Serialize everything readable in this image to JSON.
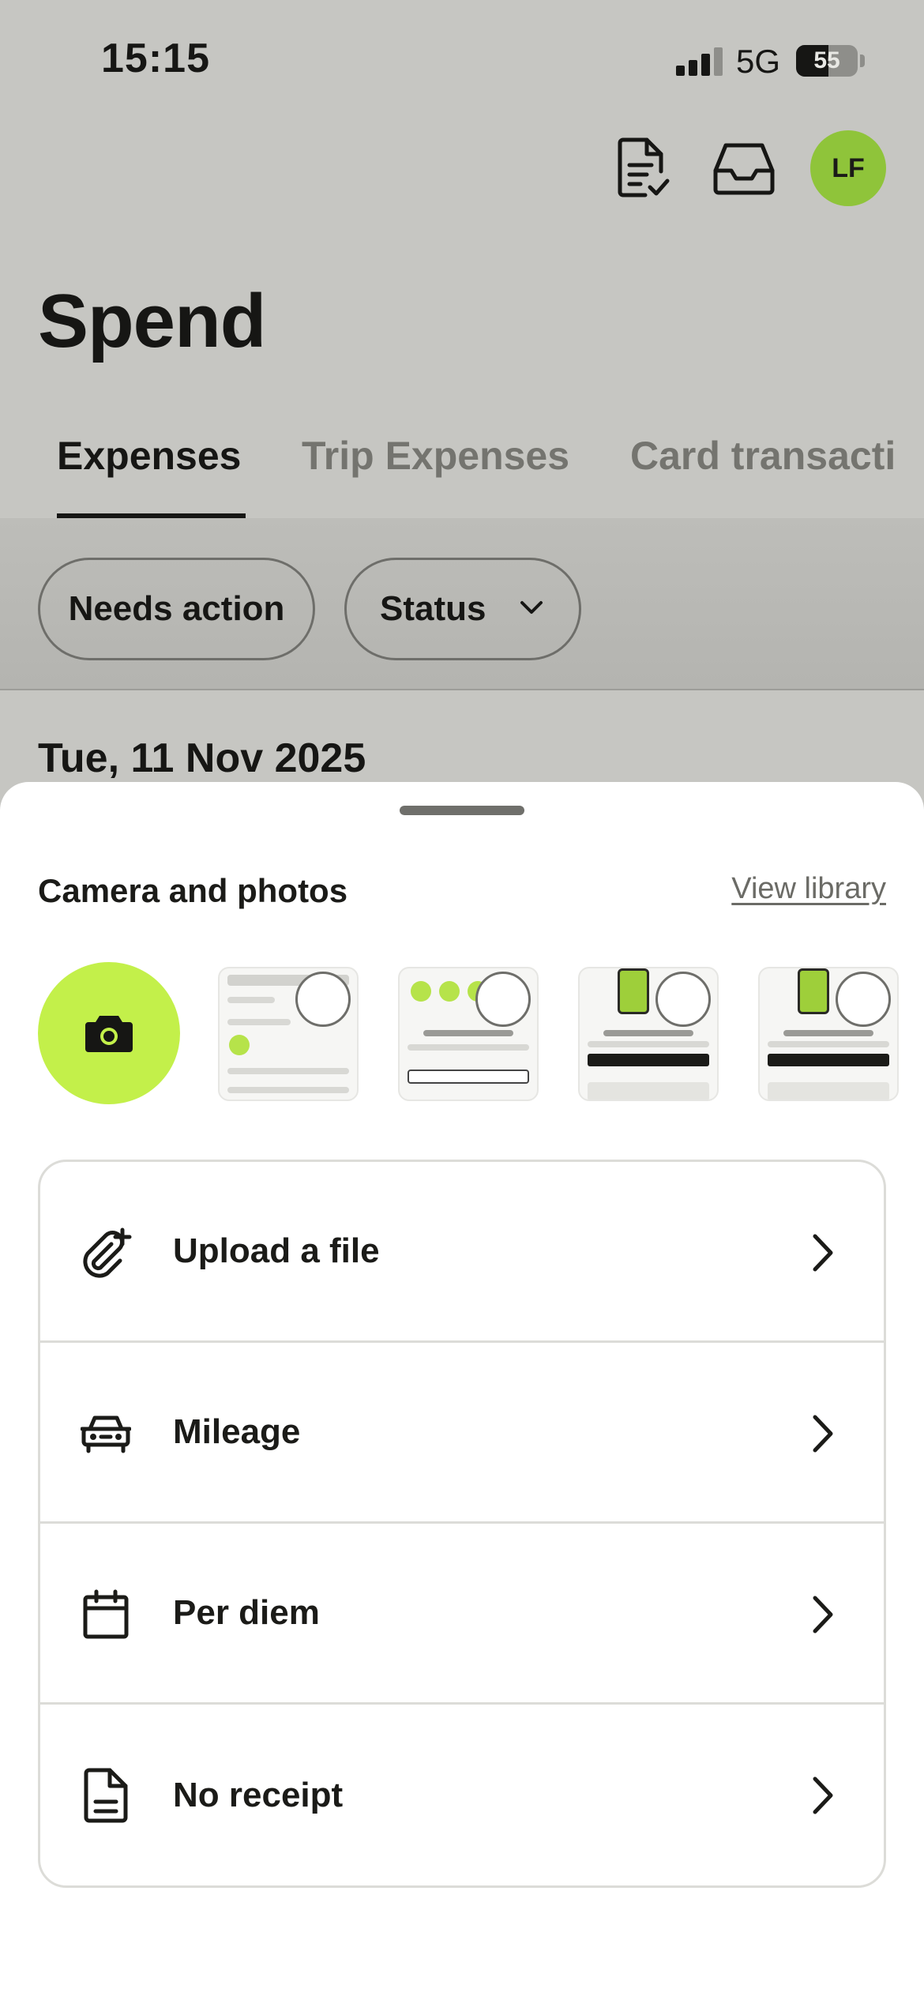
{
  "status_bar": {
    "time": "15:15",
    "network": "5G",
    "battery": "55"
  },
  "header": {
    "title": "Spend",
    "avatar_initials": "LF",
    "icons": [
      "receipt-check-icon",
      "inbox-icon"
    ]
  },
  "tabs": [
    {
      "label": "Expenses",
      "active": true
    },
    {
      "label": "Trip Expenses",
      "active": false
    },
    {
      "label": "Card transacti",
      "active": false
    }
  ],
  "filters": {
    "needs_action": "Needs action",
    "status": "Status"
  },
  "list": {
    "date_heading": "Tue, 11 Nov 2025"
  },
  "sheet": {
    "title": "Camera and photos",
    "view_library": "View library",
    "options": [
      {
        "label": "Upload a file",
        "icon": "paperclip-plus-icon"
      },
      {
        "label": "Mileage",
        "icon": "car-icon"
      },
      {
        "label": "Per diem",
        "icon": "calendar-icon"
      },
      {
        "label": "No receipt",
        "icon": "document-icon"
      }
    ]
  },
  "colors": {
    "accent_green": "#c3f04a",
    "avatar_green": "#8fc43a",
    "overlay_gray": "#c6c6c2",
    "text_dark": "#1b1b18"
  }
}
